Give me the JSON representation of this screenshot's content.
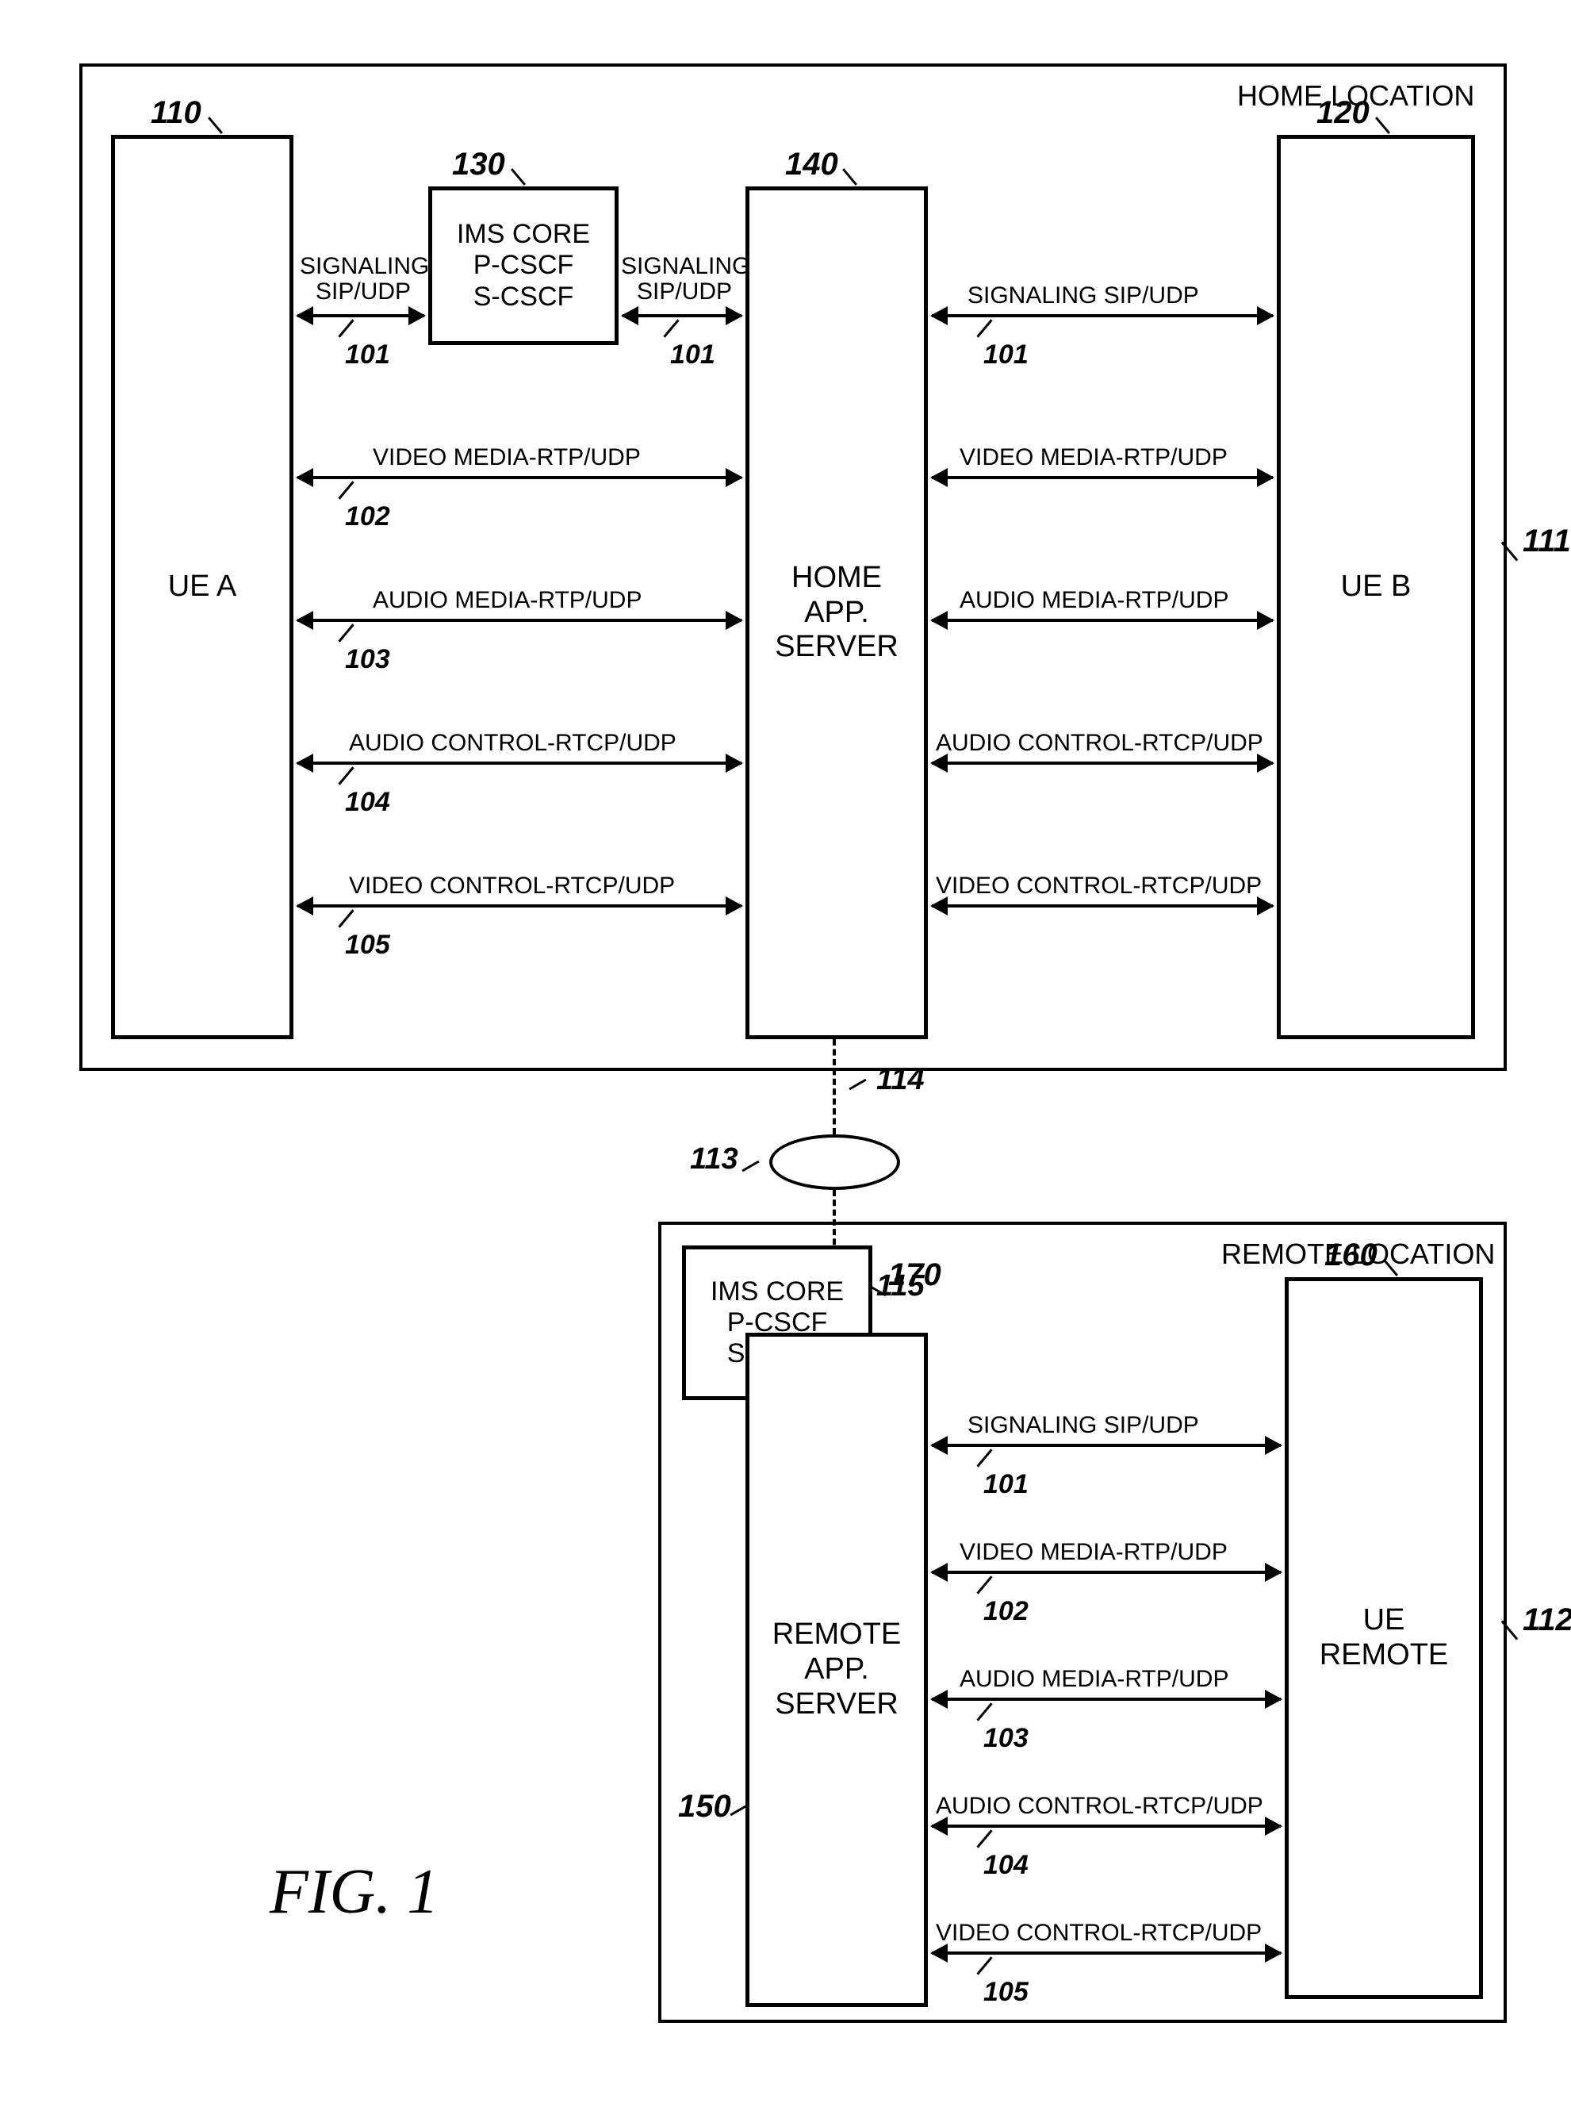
{
  "figure_label": "FIG. 1",
  "home": {
    "label": "HOME LOCATION",
    "ref": "111",
    "uea": {
      "label": "UE A",
      "ref": "110"
    },
    "ueb": {
      "label": "UE B",
      "ref": "120"
    },
    "ims": {
      "line1": "IMS CORE",
      "line2": "P-CSCF",
      "line3": "S-CSCF",
      "ref": "130"
    },
    "server": {
      "line1": "HOME",
      "line2": "APP.",
      "line3": "SERVER",
      "ref": "140"
    }
  },
  "remote": {
    "label": "REMOTE LOCATION",
    "ref": "112",
    "ue": {
      "line1": "UE",
      "line2": "REMOTE",
      "ref": "160"
    },
    "ims": {
      "line1": "IMS CORE",
      "line2": "P-CSCF",
      "line3": "S-CSCF",
      "ref": "170"
    },
    "server": {
      "line1": "REMOTE",
      "line2": "APP.",
      "line3": "SERVER",
      "ref": "150"
    }
  },
  "links": {
    "signaling": {
      "l1": "SIGNALING",
      "l2": "SIP/UDP",
      "full": "SIGNALING SIP/UDP",
      "ref": "101"
    },
    "video_media": {
      "text": "VIDEO MEDIA-RTP/UDP",
      "ref": "102"
    },
    "audio_media": {
      "text": "AUDIO MEDIA-RTP/UDP",
      "ref": "103"
    },
    "audio_ctrl": {
      "text": "AUDIO CONTROL-RTCP/UDP",
      "ref": "104"
    },
    "video_ctrl": {
      "text": "VIDEO CONTROL-RTCP/UDP",
      "ref": "105"
    }
  },
  "conn": {
    "cloud_ref": "113",
    "top_ref": "114",
    "bot_ref": "115"
  }
}
